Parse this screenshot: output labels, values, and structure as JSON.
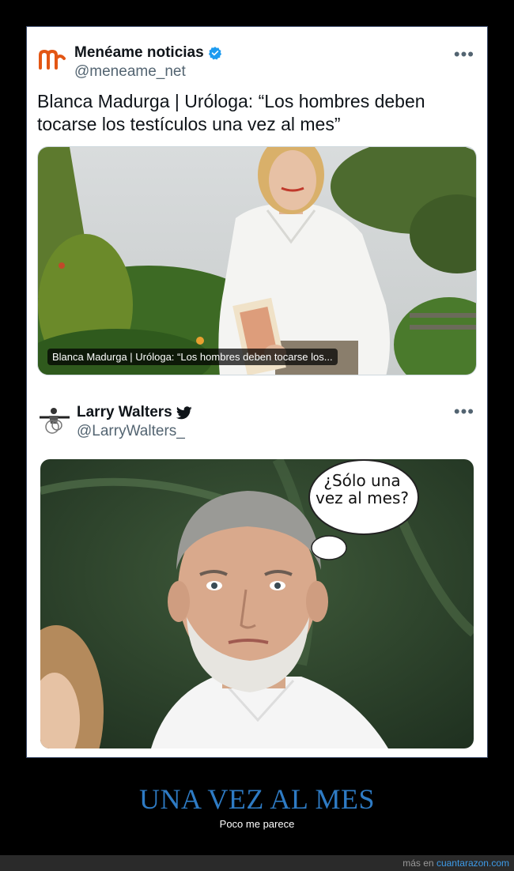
{
  "tweet1": {
    "name": "Menéame noticias",
    "handle": "@meneame_net",
    "text": "Blanca Madurga | Uróloga: “Los hombres deben tocarse los testículos una vez al mes”",
    "image_caption": "Blanca Madurga | Uróloga: “Los hombres deben tocarse los...",
    "more": "•••",
    "avatar_icon": "meneame-logo",
    "verified_icon": "verified-badge-icon",
    "accent_color": "#e35614"
  },
  "tweet2": {
    "name": "Larry Walters",
    "handle": "@LarryWalters_",
    "more": "•••",
    "speech_bubble": "¿Sólo una vez al mes?",
    "platform_icon": "twitter-bird-icon"
  },
  "post": {
    "title": "UNA VEZ AL MES",
    "subtitle": "Poco me parece"
  },
  "footer": {
    "prefix": "más en",
    "site": "cuantarazon.com"
  }
}
